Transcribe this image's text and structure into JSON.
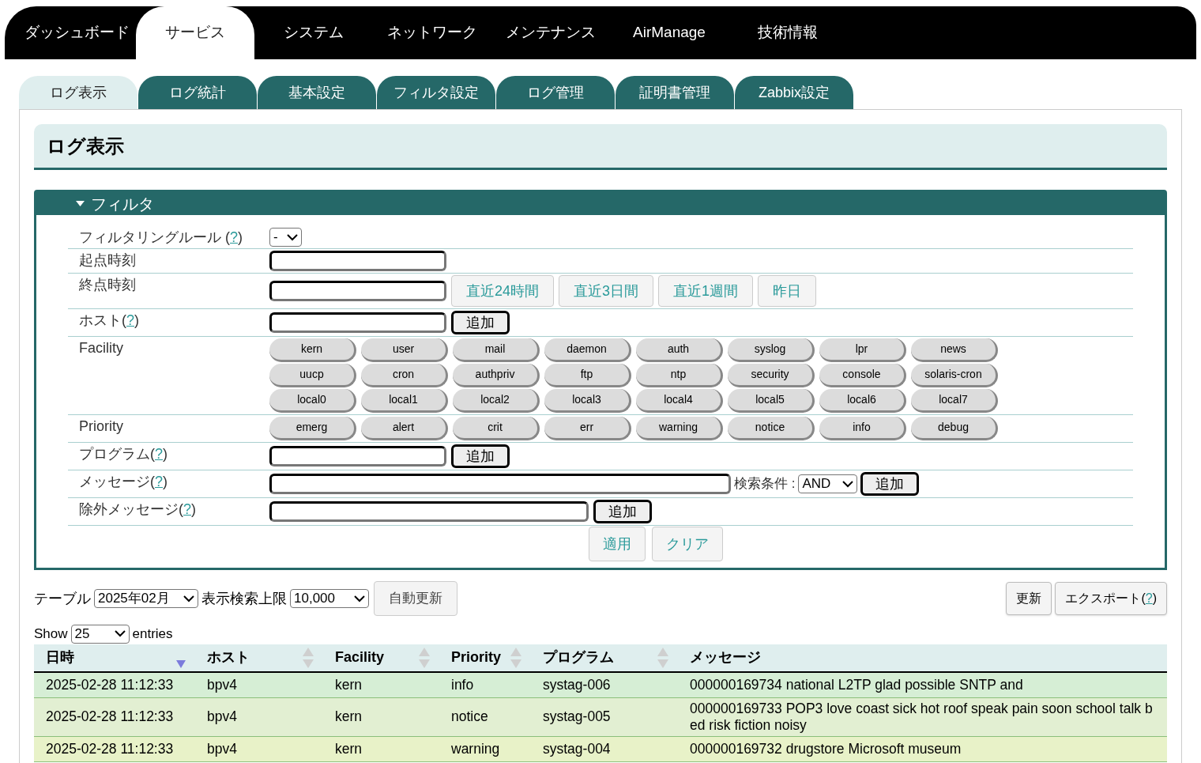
{
  "top_nav": [
    {
      "label": "ダッシュボード",
      "selected": false
    },
    {
      "label": "サービス",
      "selected": true
    },
    {
      "label": "システム",
      "selected": false
    },
    {
      "label": "ネットワーク",
      "selected": false
    },
    {
      "label": "メンテナンス",
      "selected": false
    },
    {
      "label": "AirManage",
      "selected": false
    },
    {
      "label": "技術情報",
      "selected": false
    }
  ],
  "sub_tabs": [
    {
      "label": "ログ表示",
      "selected": true
    },
    {
      "label": "ログ統計",
      "selected": false
    },
    {
      "label": "基本設定",
      "selected": false
    },
    {
      "label": "フィルタ設定",
      "selected": false
    },
    {
      "label": "ログ管理",
      "selected": false
    },
    {
      "label": "証明書管理",
      "selected": false
    },
    {
      "label": "Zabbix設定",
      "selected": false
    }
  ],
  "page_title": "ログ表示",
  "filter": {
    "title": "フィルタ",
    "expanded": true,
    "rows": [
      {
        "kind": "select",
        "label": "フィルタリングルール (",
        "help": "?",
        "label_after": ")",
        "value": "-"
      },
      {
        "kind": "input",
        "label": "起点時刻"
      },
      {
        "kind": "input_presets",
        "label": "終点時刻",
        "presets": [
          "直近24時間",
          "直近3日間",
          "直近1週間",
          "昨日"
        ]
      },
      {
        "kind": "input_add",
        "label": "ホスト(",
        "help": "?",
        "label_after": ")",
        "button": "追加"
      },
      {
        "kind": "pills",
        "label": "Facility",
        "pills": [
          "kern",
          "user",
          "mail",
          "daemon",
          "auth",
          "syslog",
          "lpr",
          "news",
          "uucp",
          "cron",
          "authpriv",
          "ftp",
          "ntp",
          "security",
          "console",
          "solaris-cron",
          "local0",
          "local1",
          "local2",
          "local3",
          "local4",
          "local5",
          "local6",
          "local7"
        ]
      },
      {
        "kind": "pills",
        "label": "Priority",
        "pills": [
          "emerg",
          "alert",
          "crit",
          "err",
          "warning",
          "notice",
          "info",
          "debug"
        ]
      },
      {
        "kind": "input_add",
        "label": "プログラム(",
        "help": "?",
        "label_after": ")",
        "button": "追加"
      },
      {
        "kind": "message",
        "label": "メッセージ(",
        "help": "?",
        "label_after": ")",
        "condition_label": "検索条件 :",
        "condition": "AND",
        "button": "追加"
      },
      {
        "kind": "wide_add",
        "label": "除外メッセージ(",
        "help": "?",
        "label_after": ")",
        "button": "追加"
      }
    ],
    "actions": [
      "適用",
      "クリア"
    ]
  },
  "toolbar": {
    "table_label": "テーブル",
    "table_value": "2025年02月",
    "limit_label": "表示検索上限",
    "limit_value": "10,000",
    "auto_refresh": "自動更新",
    "refresh": "更新",
    "export": "エクスポート(",
    "export_help": "?",
    "export_after": ")"
  },
  "length": {
    "before": "Show",
    "value": "25",
    "after": "entries"
  },
  "table": {
    "columns": [
      {
        "label": "日時",
        "sortable": true,
        "sorted_descending": true
      },
      {
        "label": "ホスト",
        "sortable": true,
        "sorted_descending": false
      },
      {
        "label": "Facility",
        "sortable": true,
        "sorted_descending": false
      },
      {
        "label": "Priority",
        "sortable": true,
        "sorted_descending": false
      },
      {
        "label": "プログラム",
        "sortable": true,
        "sorted_descending": false
      },
      {
        "label": "メッセージ",
        "sortable": false,
        "sorted_descending": false
      }
    ],
    "rows": [
      {
        "color": "#d6eed5",
        "cells": [
          "2025-02-28 11:12:33",
          "bpv4",
          "kern",
          "info",
          "systag-006",
          "000000169734 national L2TP glad possible SNTP and"
        ]
      },
      {
        "color": "#e2efd2",
        "cells": [
          "2025-02-28 11:12:33",
          "bpv4",
          "kern",
          "notice",
          "systag-005",
          "000000169733 POP3 love coast sick hot roof speak pain soon school talk bed risk fiction noisy"
        ]
      },
      {
        "color": "#e8f2c8",
        "cells": [
          "2025-02-28 11:12:33",
          "bpv4",
          "kern",
          "warning",
          "systag-004",
          "000000169732 drugstore Microsoft museum"
        ]
      }
    ]
  }
}
